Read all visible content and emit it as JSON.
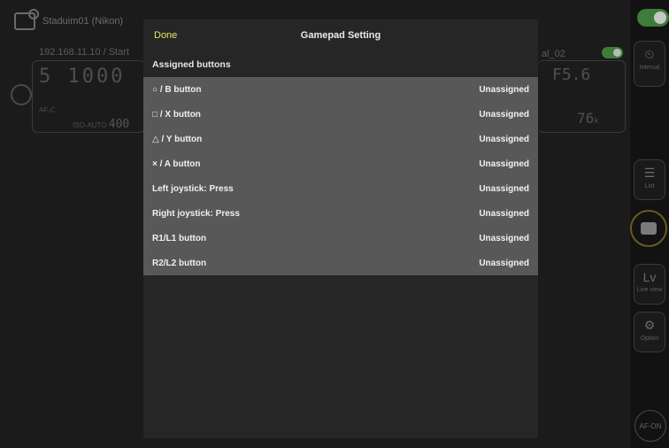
{
  "background": {
    "camera_name": "Staduim01 (Nikon)",
    "status": "192.168.11.10 / Start",
    "shutter_display": "5   1000",
    "af_mode": "AF-C",
    "iso_label": "ISO-AUTO",
    "iso_value": "400",
    "second_camera_suffix": "al_02",
    "aperture_display": "F5.6",
    "shots_remaining": "76",
    "shots_unit": "k"
  },
  "sidebar": {
    "interval_label": "Interval",
    "list_label": "List",
    "liveview_glyph": "Lv",
    "liveview_label": "Live view",
    "option_label": "Option",
    "af_on_label": "AF-ON"
  },
  "modal": {
    "done_label": "Done",
    "title": "Gamepad Setting",
    "section_header": "Assigned buttons",
    "rows": [
      {
        "label": "○ / B button",
        "value": "Unassigned"
      },
      {
        "label": "□ / X button",
        "value": "Unassigned"
      },
      {
        "label": "△ / Y button",
        "value": "Unassigned"
      },
      {
        "label": "× / A button",
        "value": "Unassigned"
      },
      {
        "label": "Left joystick: Press",
        "value": "Unassigned"
      },
      {
        "label": "Right joystick: Press",
        "value": "Unassigned"
      },
      {
        "label": "R1/L1 button",
        "value": "Unassigned"
      },
      {
        "label": "R2/L2 button",
        "value": "Unassigned"
      }
    ]
  },
  "colors": {
    "accent_done": "#e8e26a",
    "toggle_on": "#3e7c39",
    "list_bg": "#585858"
  }
}
